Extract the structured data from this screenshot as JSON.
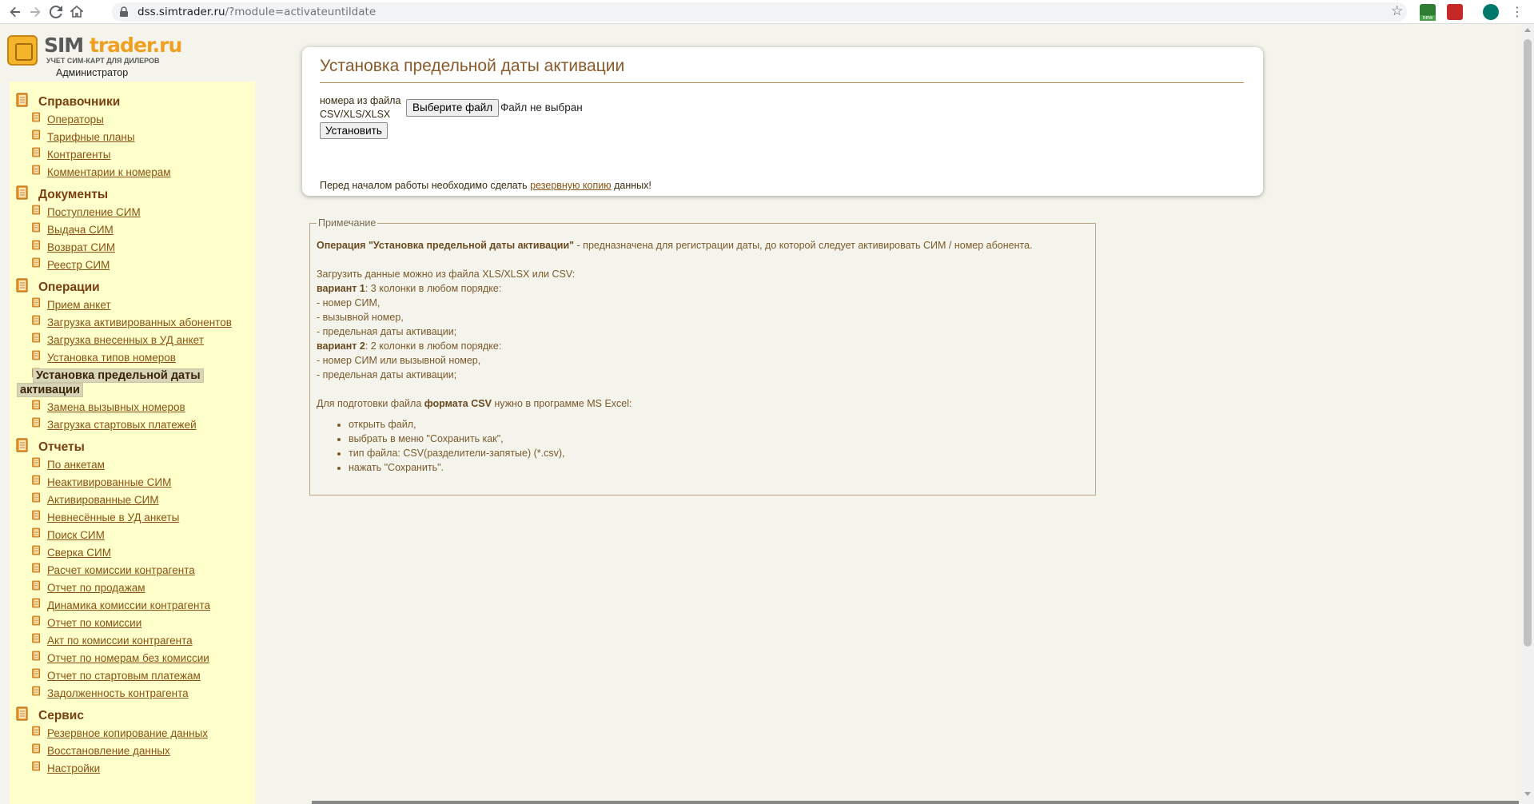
{
  "browser": {
    "url_host": "dss.simtrader.ru",
    "url_path": "/?module=activateuntildate",
    "ext_new_label": "new"
  },
  "app": {
    "logo_sim": "SIM",
    "logo_trader": "trader.ru",
    "logo_sub": "УЧЕТ СИМ-КАРТ ДЛЯ ДИЛЕРОВ",
    "user_role": "Администратор"
  },
  "sidebar": {
    "sections": [
      {
        "title": "Справочники",
        "items": [
          "Операторы",
          "Тарифные планы",
          "Контрагенты",
          "Комментарии к номерам"
        ]
      },
      {
        "title": "Документы",
        "items": [
          "Поступление СИМ",
          "Выдача СИМ",
          "Возврат СИМ",
          "Реестр СИМ"
        ]
      },
      {
        "title": "Операции",
        "items": [
          "Прием анкет",
          "Загрузка активированных абонентов",
          "Загрузка внесенных в УД анкет",
          "Установка типов номеров"
        ],
        "active_line1": "Установка предельной даты",
        "active_line2": "активации",
        "items_after": [
          "Замена вызывных номеров",
          "Загрузка стартовых платежей"
        ]
      },
      {
        "title": "Отчеты",
        "items": [
          "По анкетам",
          "Неактивированные СИМ",
          "Активированные СИМ",
          "Невнесённые в УД анкеты",
          "Поиск СИМ",
          "Сверка СИМ",
          "Расчет комиссии контрагента",
          "Отчет по продажам",
          "Динамика комиссии контрагента",
          "Отчет по комиссии",
          "Акт по комиссии контрагента",
          "Отчет по номерам без комиссии",
          "Отчет по стартовым платежам",
          "Задолженность контрагента"
        ]
      },
      {
        "title": "Сервис",
        "items": [
          "Резервное копирование данных",
          "Восстановление данных",
          "Настройки"
        ]
      }
    ]
  },
  "main": {
    "title": "Установка предельной даты активации",
    "file_label_1": "номера из файла",
    "file_label_2": "CSV/XLS/XLSX",
    "file_button": "Выберите файл",
    "file_status": "Файл не выбран",
    "submit_button": "Установить",
    "backup_prefix": "Перед началом работы необходимо сделать ",
    "backup_link": "резервную копию",
    "backup_suffix": " данных!"
  },
  "note": {
    "legend": "Примечание",
    "op_bold": "Операция \"Установка предельной даты активации\"",
    "op_rest": " - предназначена для регистрации даты, до которой следует активировать СИМ / номер абонента.",
    "load_line": "Загрузить данные можно из файла XLS/XLSX или CSV:",
    "v1_bold": "вариант 1",
    "v1_rest": ": 3 колонки в любом порядке:",
    "v1_items": [
      "- номер СИМ,",
      "- вызывной номер,",
      "- предельная даты активации;"
    ],
    "v2_bold": "вариант 2",
    "v2_rest": ": 2 колонки в любом порядке:",
    "v2_items": [
      "- номер СИМ или вызывной номер,",
      "- предельная даты активации;"
    ],
    "csv_prefix": "Для подготовки файла ",
    "csv_bold": "формата CSV",
    "csv_suffix": " нужно в программе MS Excel:",
    "steps": [
      "открыть файл,",
      "выбрать в меню \"Сохранить как\",",
      "тип файла: CSV(разделители-запятые) (*.csv),",
      "нажать \"Сохранить\"."
    ]
  },
  "colors": {
    "sidebar_bg": "#ffffcc",
    "page_bg": "#f5f4ec",
    "link": "#8a5212",
    "heading": "#7a3e10"
  }
}
